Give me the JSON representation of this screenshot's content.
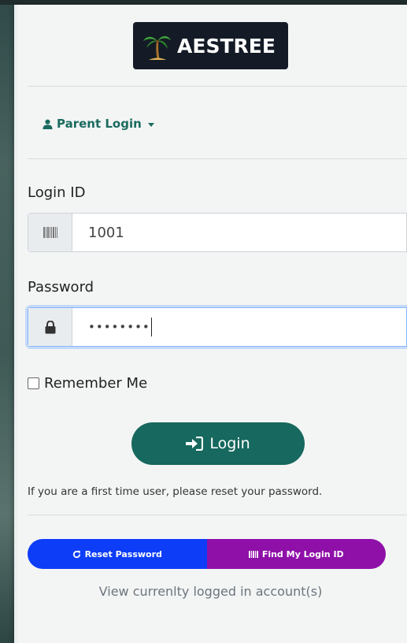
{
  "logo": {
    "text": "AESTREE"
  },
  "role_selector": {
    "label": "Parent Login"
  },
  "login_id": {
    "label": "Login ID",
    "value": "1001"
  },
  "password": {
    "label": "Password",
    "value": "••••••••"
  },
  "remember": {
    "label": "Remember Me"
  },
  "login_button": {
    "label": "Login"
  },
  "hint": {
    "text": "If you are a first time user, please reset your password."
  },
  "actions": {
    "reset_label": "Reset Password",
    "find_label": "Find My Login ID"
  },
  "view_accounts": {
    "text": "View currenlty logged in account(s)"
  },
  "colors": {
    "primary": "#17685e",
    "reset": "#0d3df7",
    "find": "#8f10a9",
    "logo_bg": "#141b26"
  }
}
